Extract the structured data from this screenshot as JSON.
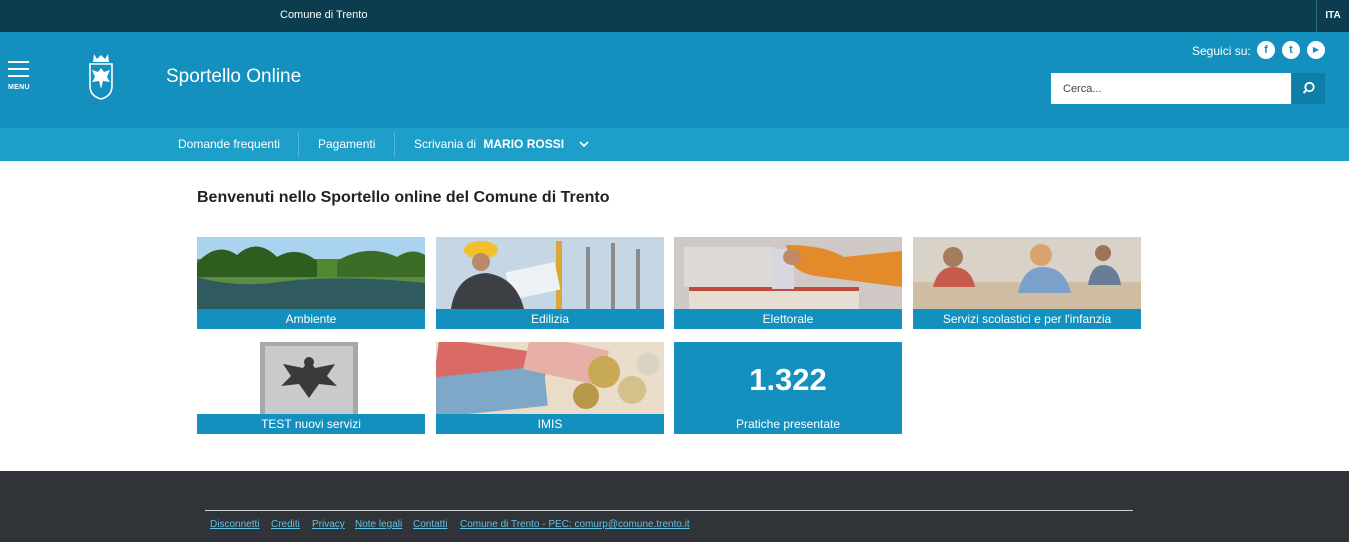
{
  "topbar": {
    "org": "Comune di Trento",
    "lang": "ITA"
  },
  "header": {
    "menu_label": "MENU",
    "title": "Sportello Online",
    "follow": "Seguici su:",
    "social": [
      {
        "icon": "facebook-icon",
        "glyph": "f"
      },
      {
        "icon": "twitter-icon",
        "glyph": "t"
      },
      {
        "icon": "youtube-icon",
        "glyph": "▶"
      }
    ],
    "search_placeholder": "Cerca..."
  },
  "nav": {
    "faq": "Domande frequenti",
    "payments": "Pagamenti",
    "desk_prefix": "Scrivania di",
    "user": "MARIO ROSSI"
  },
  "main": {
    "welcome": "Benvenuti nello Sportello online del Comune di Trento",
    "tiles": [
      {
        "label": "Ambiente"
      },
      {
        "label": "Edilizia"
      },
      {
        "label": "Elettorale"
      },
      {
        "label": "Servizi scolastici e per l'infanzia"
      },
      {
        "label": "TEST nuovi servizi"
      },
      {
        "label": "IMIS"
      }
    ],
    "counter": {
      "value": "1.322",
      "label": "Pratiche presentate"
    }
  },
  "footer": {
    "links": [
      "Disconnetti",
      "Crediti",
      "Privacy",
      "Note legali",
      "Contatti",
      "Comune di Trento - PEC: comurp@comune.trento.it"
    ]
  },
  "colors": {
    "topbar": "#0b3d4e",
    "header": "#1390bd",
    "nav": "#1e9fc9",
    "footer": "#303438",
    "link": "#5fc2e6"
  }
}
